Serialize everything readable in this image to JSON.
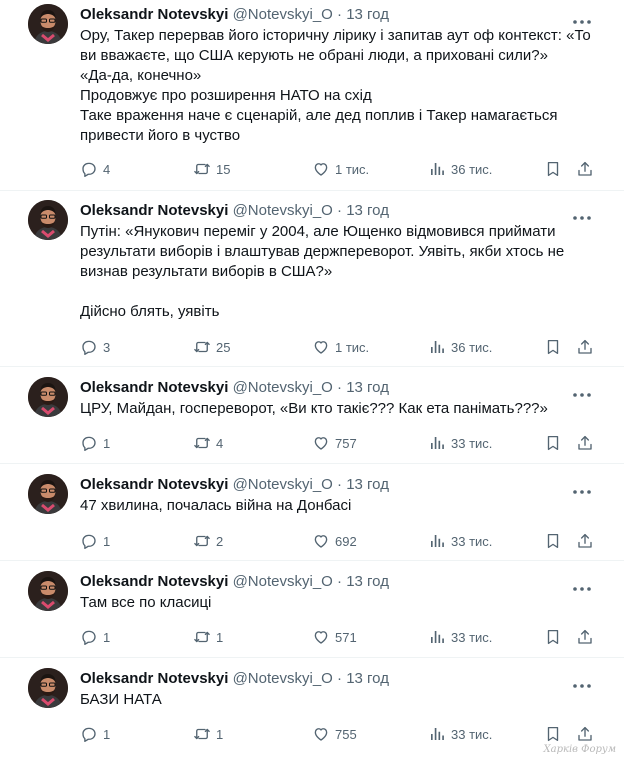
{
  "tweets": [
    {
      "name": "Oleksandr Notevskyi",
      "handle": "@Notevskyi_O",
      "time": "13 год",
      "lines": [
        "Ору, Такер перервав його історичну лірику і запитав аут оф контекст: «То",
        "ви вважаєте, що США керують не обрані люди, а приховані сили?»",
        "«Да-да, конечно»",
        "Продовжує про розширення НАТО на схід",
        "Таке враження наче є сценарій, але дед поплив і Такер намагається",
        "привести його в чуство"
      ],
      "replies": "4",
      "reposts": "15",
      "likes": "1 тис.",
      "views": "36 тис."
    },
    {
      "name": "Oleksandr Notevskyi",
      "handle": "@Notevskyi_O",
      "time": "13 год",
      "lines": [
        "Путін: «Янукович переміг у 2004, але Ющенко відмовився приймати",
        "результати виборів і влаштував держпереворот. Уявіть, якби хтось не",
        "визнав результати виборів в США?»",
        "",
        "Дійсно блять, уявіть"
      ],
      "replies": "3",
      "reposts": "25",
      "likes": "1 тис.",
      "views": "36 тис."
    },
    {
      "name": "Oleksandr Notevskyi",
      "handle": "@Notevskyi_O",
      "time": "13 год",
      "lines": [
        "ЦРУ, Майдан, госпереворот, «Ви кто такіє??? Как ета панімать???»"
      ],
      "replies": "1",
      "reposts": "4",
      "likes": "757",
      "views": "33 тис."
    },
    {
      "name": "Oleksandr Notevskyi",
      "handle": "@Notevskyi_O",
      "time": "13 год",
      "lines": [
        "47 хвилина, почалась війна на Донбасі"
      ],
      "replies": "1",
      "reposts": "2",
      "likes": "692",
      "views": "33 тис."
    },
    {
      "name": "Oleksandr Notevskyi",
      "handle": "@Notevskyi_O",
      "time": "13 год",
      "lines": [
        "Там все по класиці"
      ],
      "replies": "1",
      "reposts": "1",
      "likes": "571",
      "views": "33 тис."
    },
    {
      "name": "Oleksandr Notevskyi",
      "handle": "@Notevskyi_O",
      "time": "13 год",
      "lines": [
        "БАЗИ НАТА"
      ],
      "replies": "1",
      "reposts": "1",
      "likes": "755",
      "views": "33 тис."
    }
  ],
  "watermark": "Харків Форум",
  "icons": {
    "more": "more-dots-icon",
    "reply": "reply-bubble-icon",
    "repost": "repost-arrows-icon",
    "like": "heart-outline-icon",
    "views": "views-bar-chart-icon",
    "bookmark": "bookmark-icon",
    "share": "share-upload-icon"
  },
  "colors": {
    "text": "#0f1419",
    "secondary": "#536471",
    "divider": "#eff3f4"
  }
}
